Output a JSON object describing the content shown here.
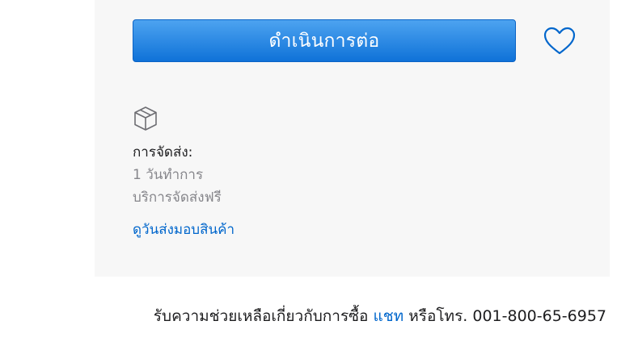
{
  "purchase": {
    "continue_label": "ดำเนินการต่อ",
    "favorite_icon": "heart-icon"
  },
  "delivery": {
    "icon": "box-icon",
    "title": "การจัดส่ง:",
    "lead_time": "1 วันทำการ",
    "cost": "บริการจัดส่งฟรี",
    "check_dates_link": "ดูวันส่งมอบสินค้า"
  },
  "help": {
    "prefix": "รับความช่วยเหลือเกี่ยวกับการซื้อ ",
    "chat_link": "แชท",
    "suffix": " หรือโทร. 001-800-65-6957"
  },
  "colors": {
    "accent": "#0071e3",
    "link": "#0066cc",
    "panel_bg": "#f7f7f7",
    "secondary_text": "#86868b"
  }
}
